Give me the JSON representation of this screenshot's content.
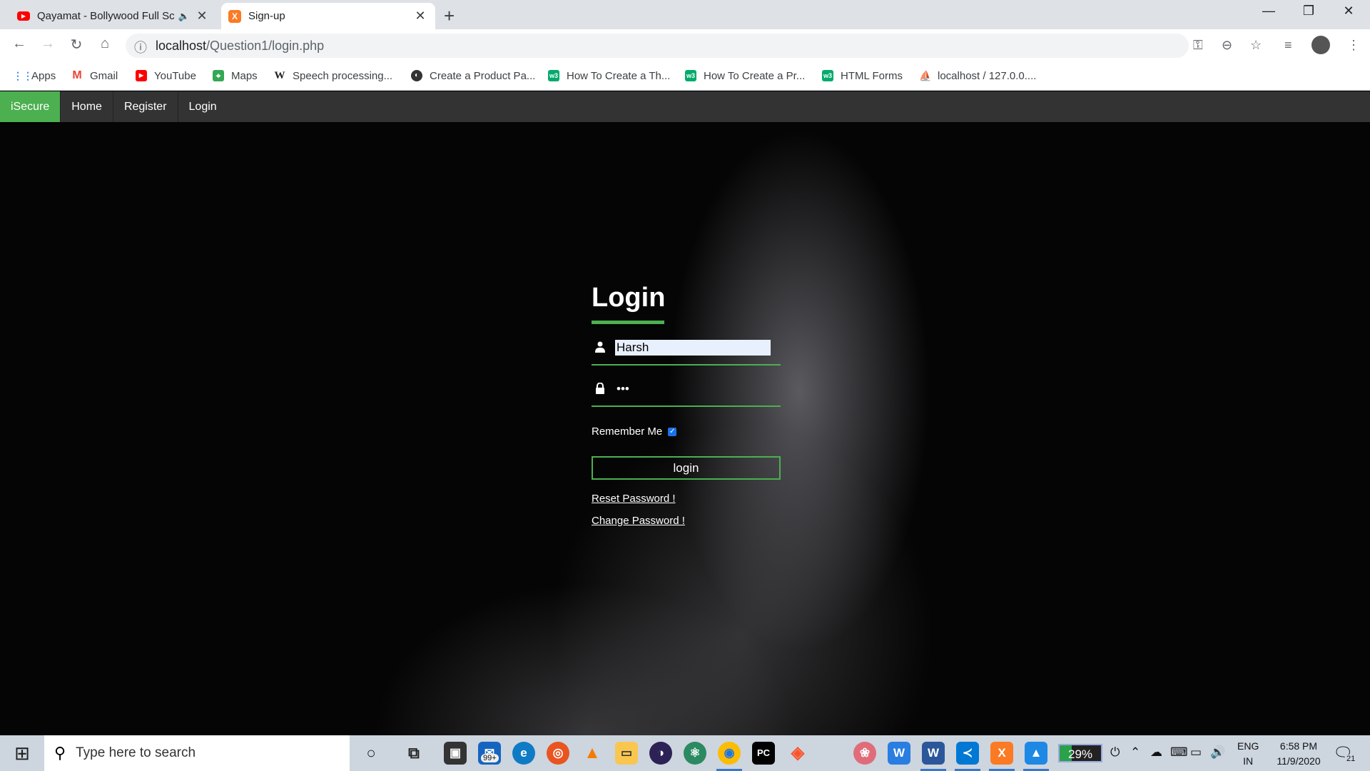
{
  "browser": {
    "tabs": [
      {
        "title": "Qayamat - Bollywood Full Sc",
        "active": false,
        "audio": true
      },
      {
        "title": "Sign-up",
        "active": true
      }
    ],
    "url_host": "localhost",
    "url_path": "/Question1/login.php",
    "bookmarks": [
      {
        "label": "Apps",
        "icon": "apps-grid-icon"
      },
      {
        "label": "Gmail",
        "icon": "gmail-icon"
      },
      {
        "label": "YouTube",
        "icon": "youtube-icon"
      },
      {
        "label": "Maps",
        "icon": "maps-icon"
      },
      {
        "label": "Speech processing...",
        "icon": "wikipedia-icon"
      },
      {
        "label": "Create a Product Pa...",
        "icon": "site-icon"
      },
      {
        "label": "How To Create a Th...",
        "icon": "w3schools-icon"
      },
      {
        "label": "How To Create a Pr...",
        "icon": "w3schools-icon"
      },
      {
        "label": "HTML Forms",
        "icon": "w3schools-icon"
      },
      {
        "label": "localhost / 127.0.0....",
        "icon": "phpmyadmin-icon"
      }
    ]
  },
  "site": {
    "nav": [
      "iSecure",
      "Home",
      "Register",
      "Login"
    ],
    "login": {
      "title": "Login",
      "username_value": "Harsh",
      "password_value": "•••",
      "remember_label": "Remember Me",
      "remember_checked": true,
      "button_label": "login",
      "reset_link": "Reset Password !",
      "change_link": "Change Password !"
    },
    "accent_color": "#4caf50"
  },
  "taskbar": {
    "search_placeholder": "Type here to search",
    "mail_badge": "99+",
    "battery": "29%",
    "lang_line1": "ENG",
    "lang_line2": "IN",
    "time": "6:58 PM",
    "date": "11/9/2020",
    "notification_count": "21"
  }
}
